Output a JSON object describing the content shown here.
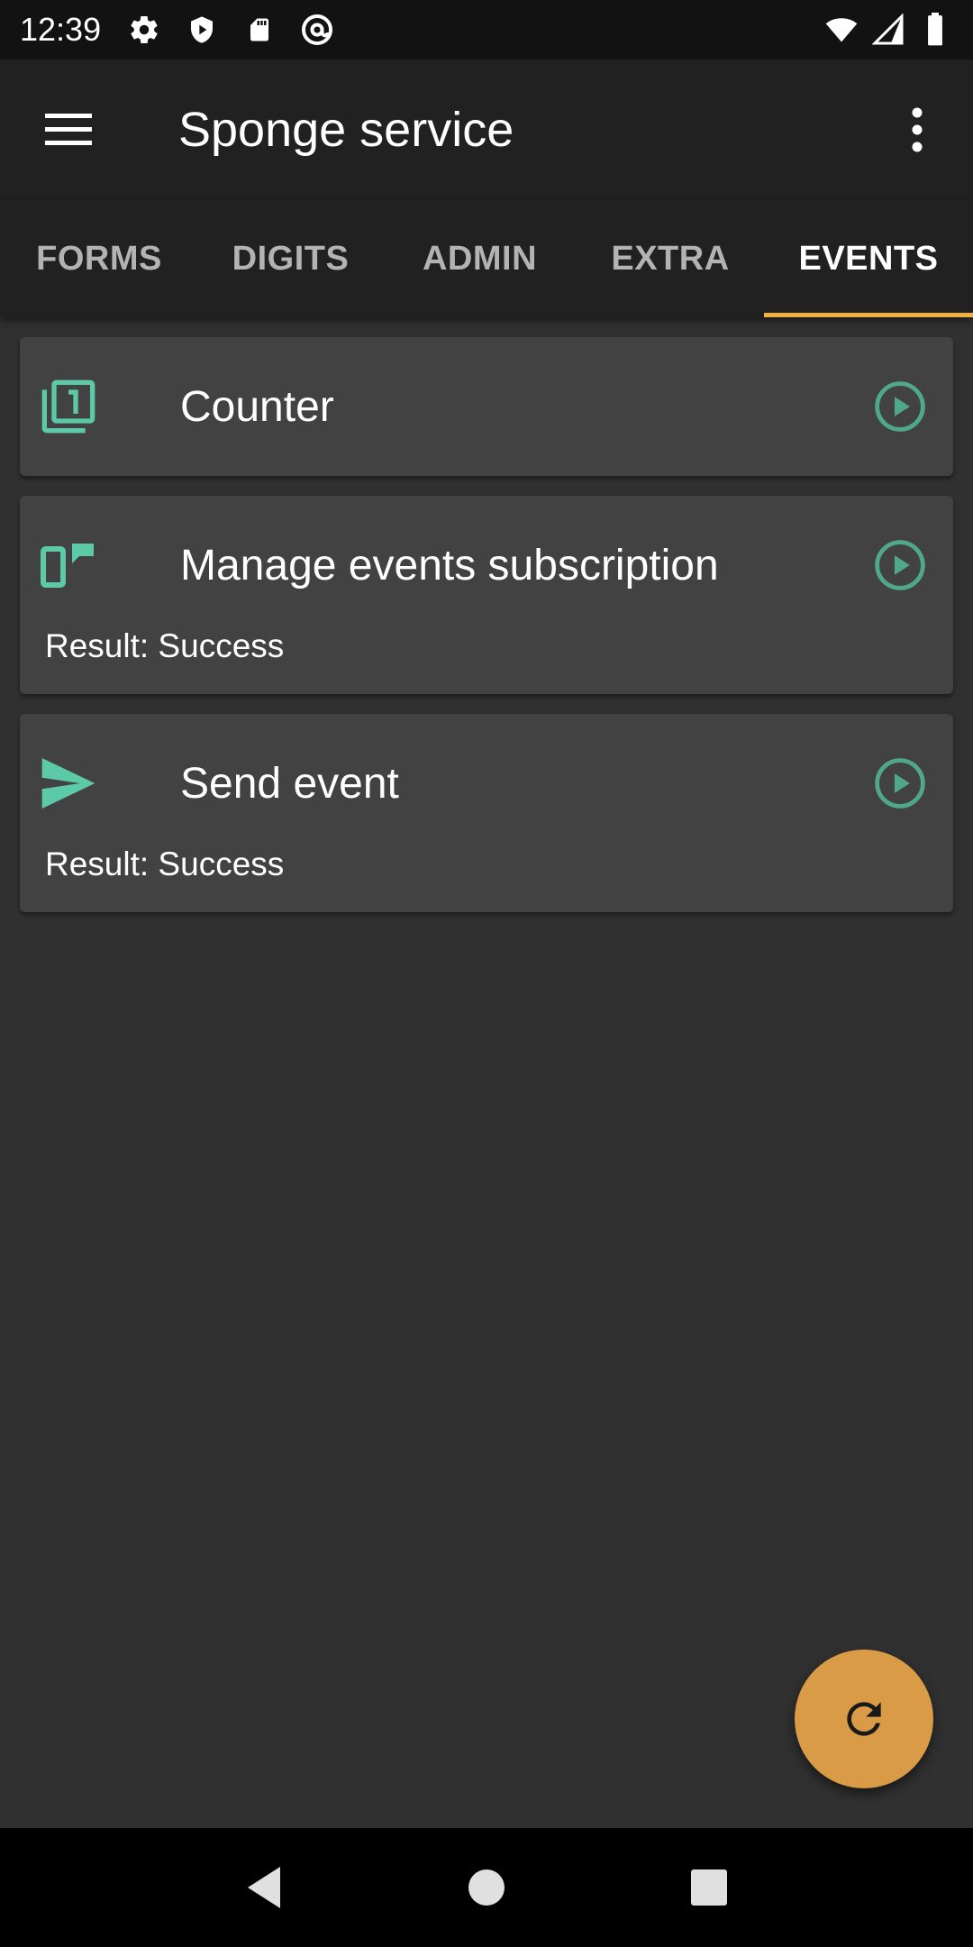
{
  "status_bar": {
    "time": "12:39",
    "left_icons": [
      "settings-icon",
      "shield-icon",
      "sd-card-icon",
      "at-sign-icon"
    ],
    "right_icons": [
      "wifi-icon",
      "signal-icon",
      "battery-icon"
    ]
  },
  "app_bar": {
    "title": "Sponge service",
    "menu_icon": "hamburger-menu-icon",
    "overflow_icon": "more-vert-icon"
  },
  "tabs": [
    {
      "label": "FORMS",
      "active": false
    },
    {
      "label": "DIGITS",
      "active": false
    },
    {
      "label": "ADMIN",
      "active": false
    },
    {
      "label": "EXTRA",
      "active": false
    },
    {
      "label": "EVENTS",
      "active": true
    }
  ],
  "actions": [
    {
      "title": "Counter",
      "icon": "counter-icon",
      "result": ""
    },
    {
      "title": "Manage events subscription",
      "icon": "devices-icon",
      "result": "Result: Success"
    },
    {
      "title": "Send event",
      "icon": "send-icon",
      "result": "Result: Success"
    }
  ],
  "fab": {
    "icon": "refresh-icon"
  },
  "colors": {
    "accent": "#f0b043",
    "fab": "#d99b45",
    "icon_teal": "#5cc9a7",
    "card": "#424242",
    "background": "#303030",
    "appbar": "#212121"
  },
  "nav_bar": {
    "icons": [
      "back-icon",
      "home-icon",
      "recents-icon"
    ]
  }
}
